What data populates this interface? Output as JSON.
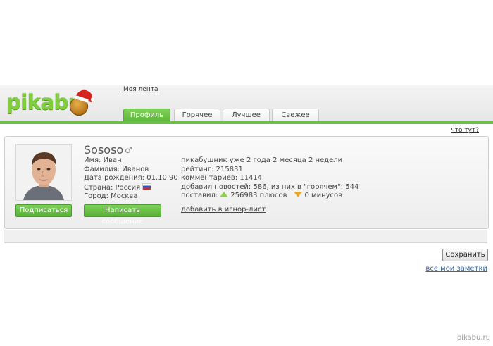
{
  "header": {
    "logo_text": "pikabu",
    "my_feed_link": "Моя лента",
    "tabs": [
      {
        "label": "Профиль",
        "active": true
      },
      {
        "label": "Горячее",
        "active": false
      },
      {
        "label": "Лучшее",
        "active": false
      },
      {
        "label": "Свежее",
        "active": false
      }
    ],
    "what_is_link": "что тут?"
  },
  "profile": {
    "username": "Sososo",
    "gender_icon": "male-symbol-icon",
    "left_info": {
      "name": "Имя: Иван",
      "surname": "Фамилия: Иванов",
      "birthdate": "Дата рождения: 01.10.90",
      "country": "Страна: Россия",
      "city": "Город: Москва"
    },
    "right_info": {
      "member_since": "пикабушник уже 2 года 2 месяца 2 недели",
      "rating": "рейтинг: 215831",
      "comments": "комментариев: 11414",
      "news_added": "добавил новостей: 586, из них в \"горячем\": 544",
      "voted_label": "поставил:",
      "pluses": "256983 плюсов",
      "minuses": "0 минусов"
    },
    "subscribe_button": "Подписаться",
    "message_button": "Написать сообщение",
    "ignore_link": "добавить в игнор-лист"
  },
  "notes": {
    "save_button": "Сохранить",
    "all_notes_link": "все мои заметки"
  },
  "watermark": "pikabu.ru",
  "colors": {
    "brand_green": "#6cc04a",
    "button_green": "#5cb83a",
    "link_blue": "#3366aa"
  }
}
